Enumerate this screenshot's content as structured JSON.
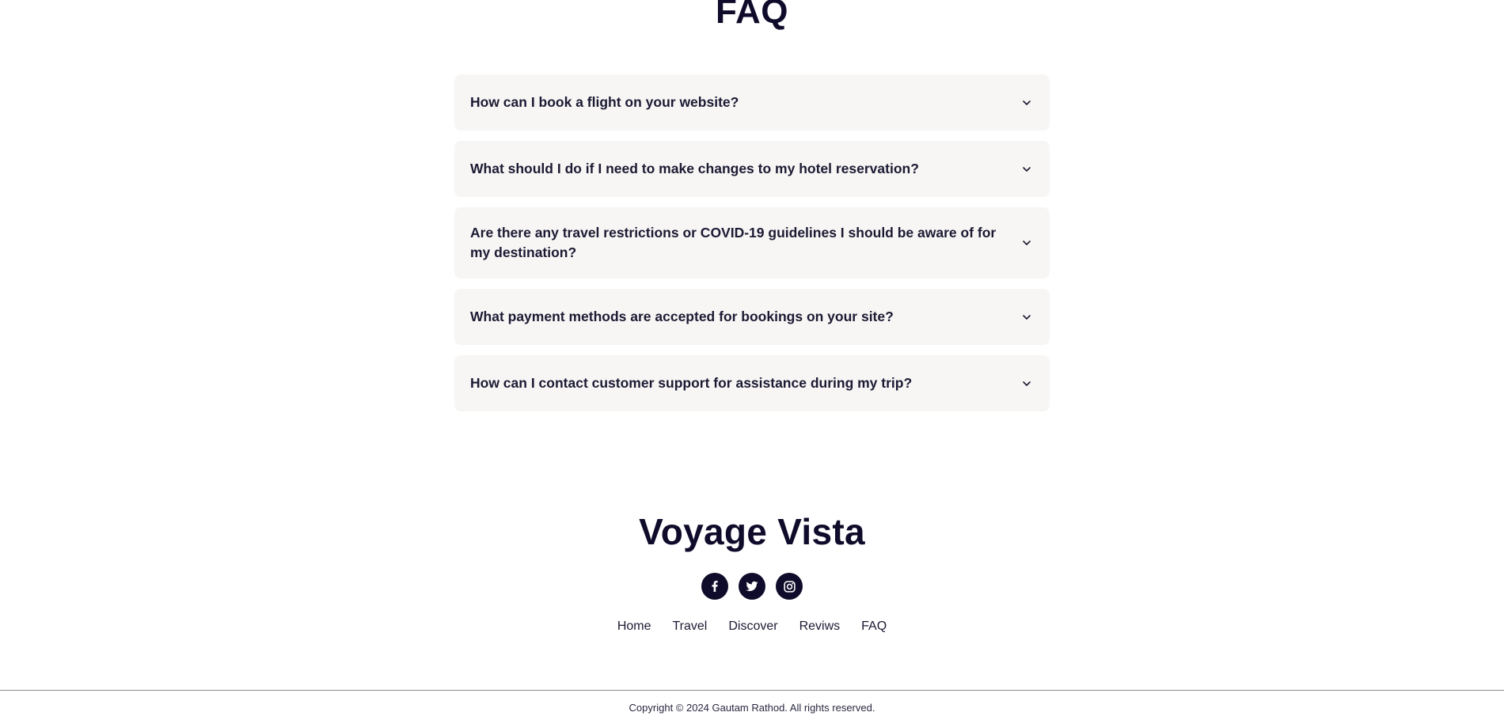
{
  "faq": {
    "title": "FAQ",
    "items": [
      {
        "question": "How can I book a flight on your website?"
      },
      {
        "question": "What should I do if I need to make changes to my hotel reservation?"
      },
      {
        "question": "Are there any travel restrictions or COVID-19 guidelines I should be aware of for my destination?"
      },
      {
        "question": "What payment methods are accepted for bookings on your site?"
      },
      {
        "question": "How can I contact customer support for assistance during my trip?"
      }
    ],
    "expand_icon": "chevron-down-icon"
  },
  "footer": {
    "brand": "Voyage Vista",
    "socials": [
      {
        "icon": "facebook-icon"
      },
      {
        "icon": "twitter-icon"
      },
      {
        "icon": "instagram-icon"
      }
    ],
    "nav": [
      {
        "label": "Home"
      },
      {
        "label": "Travel"
      },
      {
        "label": "Discover"
      },
      {
        "label": "Reviws"
      },
      {
        "label": "FAQ"
      }
    ],
    "copyright": "Copyright © 2024 Gautam Rathod. All rights reserved."
  },
  "colors": {
    "primary": "#0f0b2a",
    "card_bg": "#f7f6f4",
    "background": "#ffffff"
  }
}
